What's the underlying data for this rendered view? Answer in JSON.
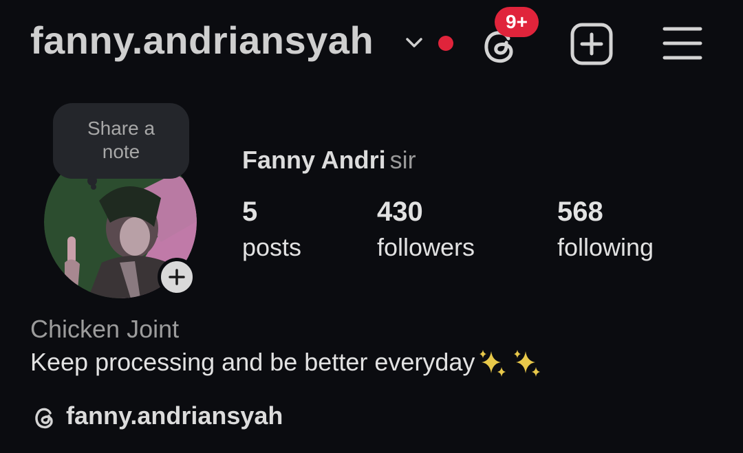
{
  "header": {
    "username": "fanny.andriansyah",
    "notification_badge": "9+",
    "icons": {
      "account_switch": "chevron-down-icon",
      "live": "live-dot-icon",
      "threads": "threads-icon",
      "create": "plus-square-icon",
      "menu": "hamburger-menu-icon"
    },
    "colors": {
      "badge": "#e0243b",
      "live_dot": "#e0243b"
    }
  },
  "profile": {
    "note_prompt_line1": "Share a",
    "note_prompt_line2": "note",
    "display_name": "Fanny Andri",
    "pronouns": "sir",
    "stats": [
      {
        "value": "5",
        "label": "posts"
      },
      {
        "value": "430",
        "label": "followers"
      },
      {
        "value": "568",
        "label": "following"
      }
    ],
    "category": "Chicken Joint",
    "bio": "Keep processing and be better everyday",
    "bio_emoji": "sparkles-icon",
    "threads_handle": "fanny.andriansyah",
    "colors": {
      "avatar_bg_left": "#2c4d2f",
      "avatar_bg_right": "#c07aa8",
      "sparkles": "#e8c84a"
    }
  }
}
